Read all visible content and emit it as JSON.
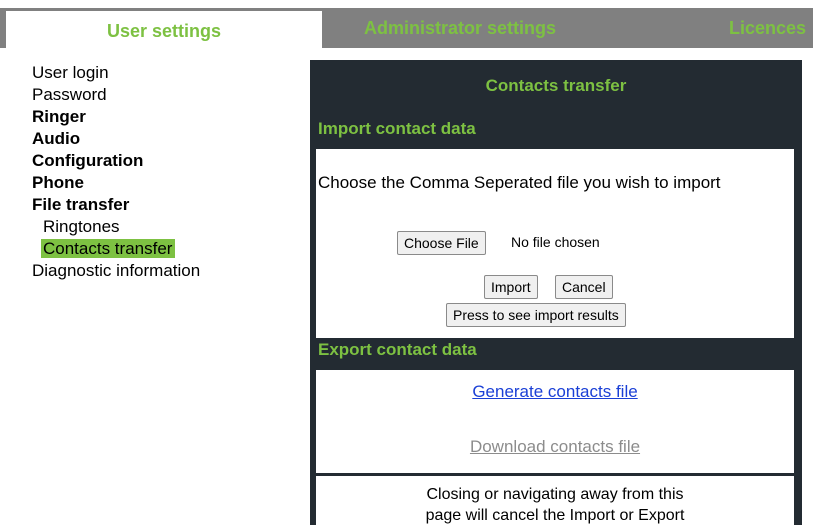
{
  "tabs": {
    "user": "User settings",
    "admin": "Administrator settings",
    "licences": "Licences"
  },
  "nav": {
    "user_login": "User login",
    "password": "Password",
    "ringer": "Ringer",
    "audio": "Audio",
    "configuration": "Configuration",
    "phone": "Phone",
    "file_transfer": "File transfer",
    "ringtones": "Ringtones",
    "contacts_transfer": "Contacts transfer",
    "diagnostic": "Diagnostic information"
  },
  "panel": {
    "title": "Contacts transfer",
    "import_heading": "Import contact data",
    "import_text": "Choose the Comma Seperated file you wish to import",
    "choose_file": "Choose File",
    "no_file": "No file chosen",
    "import_button": "Import",
    "cancel_button": "Cancel",
    "results_button": "Press to see import results",
    "export_heading": "Export contact data",
    "generate_link": "Generate contacts file",
    "download_link": "Download contacts file",
    "closing_line1": "Closing or navigating away from this",
    "closing_line2": "page will cancel the Import or Export"
  },
  "colors": {
    "accent": "#7dc142",
    "panel_bg": "#232b32",
    "tab_inactive": "#808080",
    "link": "#1a3fd6",
    "link_disabled": "#8c8c8c"
  }
}
